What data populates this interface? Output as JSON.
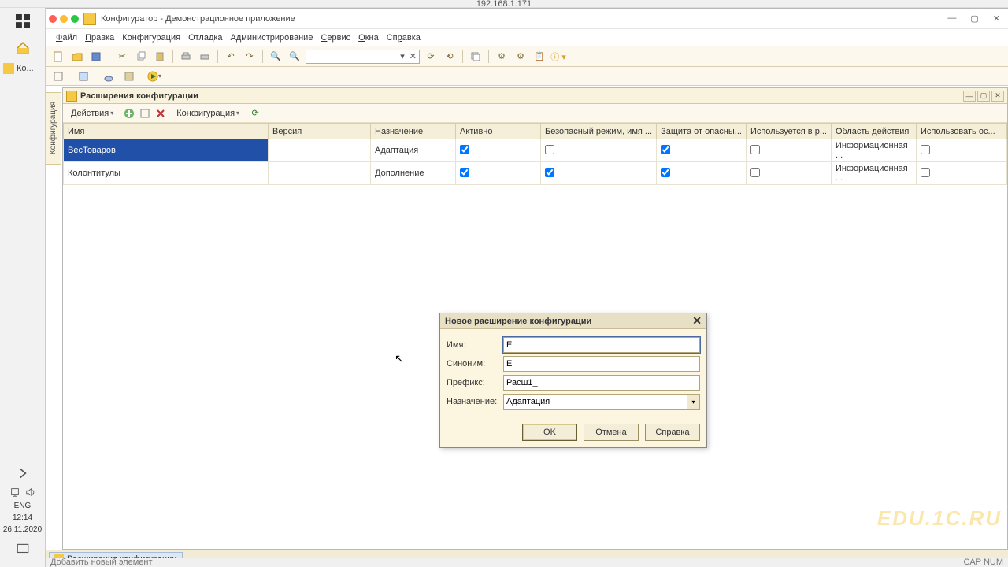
{
  "browser_address": "192.168.1.171",
  "taskbar": {
    "ko_label": "Ко...",
    "lang": "ENG",
    "time": "12:14",
    "date": "26.11.2020"
  },
  "window": {
    "title": "Конфигуратор - Демонстрационное приложение",
    "menus": [
      "Файл",
      "Правка",
      "Конфигурация",
      "Отладка",
      "Администрирование",
      "Сервис",
      "Окна",
      "Справка"
    ]
  },
  "side_tab": "Конфигурация",
  "panel": {
    "title": "Расширения конфигурации",
    "actions_label": "Действия",
    "config_label": "Конфигурация",
    "columns": [
      "Имя",
      "Версия",
      "Назначение",
      "Активно",
      "Безопасный режим, имя ...",
      "Защита от опасны...",
      "Используется в р...",
      "Область действия",
      "Использовать ос..."
    ],
    "rows": [
      {
        "name": "ВесТоваров",
        "version": "",
        "purpose": "Адаптация",
        "active": true,
        "safe": false,
        "protect": true,
        "used": false,
        "scope": "Информационная ...",
        "useos": false,
        "selected": true
      },
      {
        "name": "Колонтитулы",
        "version": "",
        "purpose": "Дополнение",
        "active": true,
        "safe": true,
        "protect": true,
        "used": false,
        "scope": "Информационная ...",
        "useos": false,
        "selected": false
      }
    ]
  },
  "dialog": {
    "title": "Новое расширение конфигурации",
    "labels": {
      "name": "Имя:",
      "synonym": "Синоним:",
      "prefix": "Префикс:",
      "purpose": "Назначение:"
    },
    "values": {
      "name": "E",
      "synonym": "E",
      "prefix": "Расш1_",
      "purpose": "Адаптация"
    },
    "buttons": {
      "ok": "OK",
      "cancel": "Отмена",
      "help": "Справка"
    }
  },
  "bottom_tab": "Расширения конфигурации",
  "watermark": "EDU.1C.RU",
  "status": {
    "left": "Добавить новый элемент",
    "right": "CAP   NUM"
  }
}
